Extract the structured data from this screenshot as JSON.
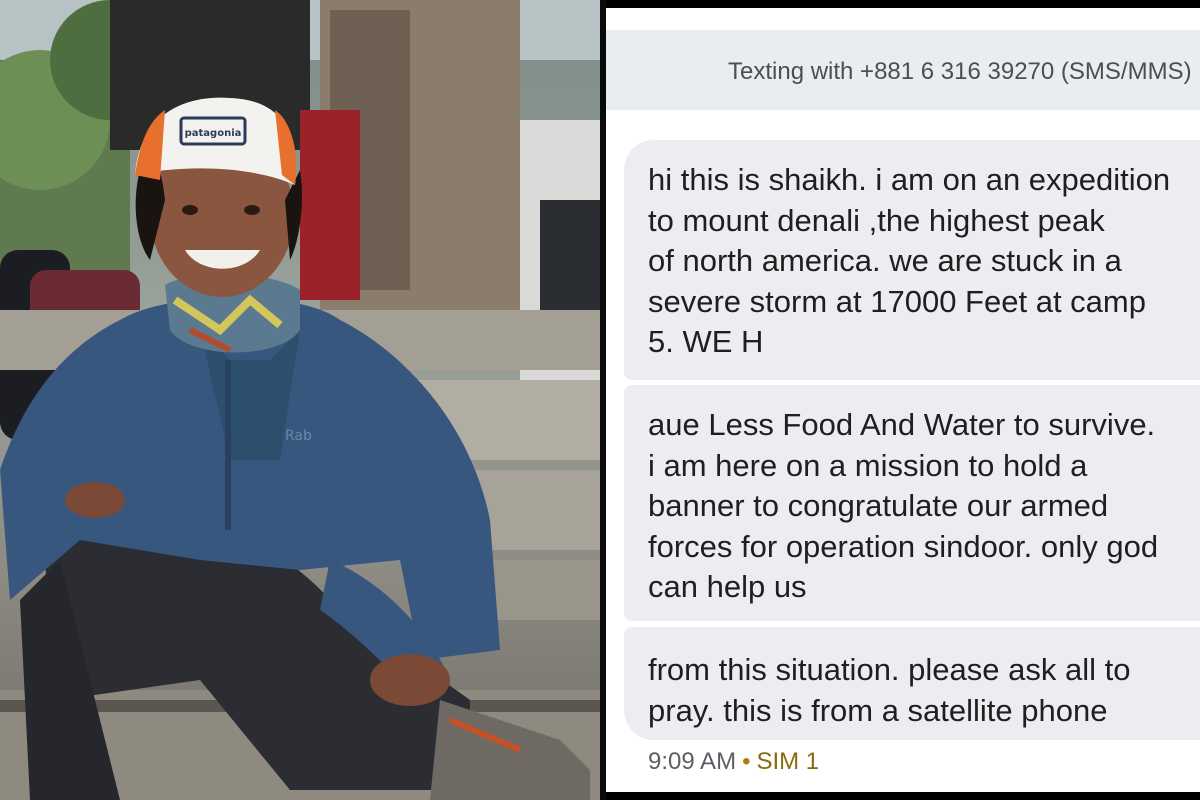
{
  "photo": {
    "description_icon": "hiker-photo",
    "cap_brand": "patagonia",
    "jacket_brand": "Rab"
  },
  "sms": {
    "header": "Texting with +881 6 316 39270 (SMS/MMS)",
    "messages": [
      {
        "lines": [
          "hi this is shaikh. i am on an expedition",
          "to mount denali ,the highest peak",
          "of north america. we are stuck in a",
          "severe storm at 17000 Feet at camp",
          "5. WE H"
        ]
      },
      {
        "lines": [
          "aue Less Food And Water to survive.",
          "i am here on a mission to hold a",
          "banner to congratulate our armed",
          "forces for operation sindoor. only god",
          "can help us"
        ]
      },
      {
        "lines": [
          "from this situation. please ask all to",
          "pray. this is from a satellite phone"
        ]
      }
    ],
    "time": "9:09 AM",
    "separator": "•",
    "sim": "SIM 1"
  },
  "colors": {
    "bubble": "#ebedf0",
    "header_bg": "#e8eef0",
    "sim_accent": "#b07a10"
  }
}
